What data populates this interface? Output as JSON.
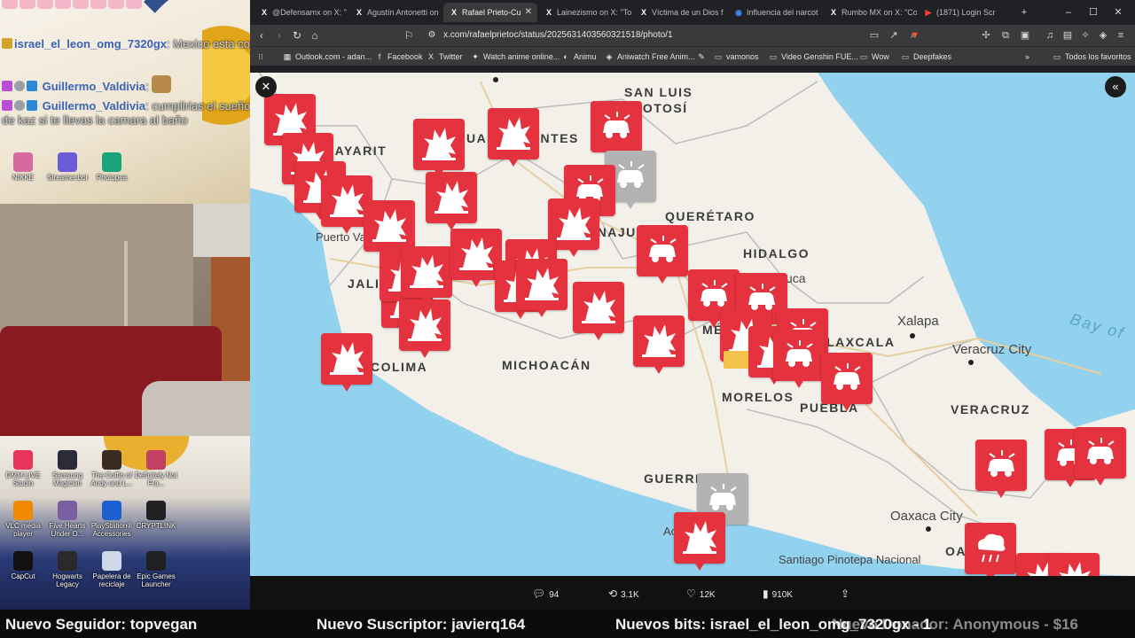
{
  "chat": {
    "messages": [
      {
        "user": "israel_el_leon_omg_7320gx",
        "text": "",
        "y": 0,
        "emotes": 8
      },
      {
        "user": "israel_el_leon_omg_7320gx",
        "text": "Mexico esta complejo",
        "y": 1
      },
      {
        "user": "Guillermo_Valdivia",
        "text": "",
        "y": 2
      },
      {
        "user": "Guillermo_Valdivia",
        "text": "cumplirias el sueño de kaz si te llevas la camara al baño",
        "y": 3
      }
    ]
  },
  "desktop_top_icons": [
    {
      "label": "NIKKE",
      "color": "#d66aa0"
    },
    {
      "label": "Streamer.bot",
      "color": "#6b5bd6"
    },
    {
      "label": "Photopea",
      "color": "#1aa37a"
    }
  ],
  "desktop_bottom_icons": [
    {
      "label": "DMM LIVE Studio",
      "color": "#e8345c"
    },
    {
      "label": "Samsung Magician",
      "color": "#2b2b3a"
    },
    {
      "label": "The Coffin of Andy and L...",
      "color": "#3a2b22"
    },
    {
      "label": "Definitely Not Fra...",
      "color": "#c24060"
    },
    {
      "label": "VLC media player",
      "color": "#f08a00"
    },
    {
      "label": "Five Hearts Under O...",
      "color": "#7a5fa0"
    },
    {
      "label": "PlayStation® Accessories",
      "color": "#1d5fd0"
    },
    {
      "label": "CRYPTLINK",
      "color": "#222"
    },
    {
      "label": "CapCut",
      "color": "#111"
    },
    {
      "label": "Hogwarts Legacy",
      "color": "#2a2a2a"
    },
    {
      "label": "Papelera de reciclaje",
      "color": "#cfd8e8"
    },
    {
      "label": "Epic Games Launcher",
      "color": "#202020"
    }
  ],
  "browser": {
    "tabs": [
      {
        "icon": "X",
        "title": "@Defensamx on X: \"",
        "active": false
      },
      {
        "icon": "X",
        "title": "Agustín Antonetti on",
        "active": false
      },
      {
        "icon": "X",
        "title": "Rafael Prieto-Cu",
        "active": true
      },
      {
        "icon": "X",
        "title": "Lainezismo on X: \"To",
        "active": false
      },
      {
        "icon": "X",
        "title": "Víctima de un Dios f",
        "active": false
      },
      {
        "icon": "◉",
        "title": "Influencia del narcot",
        "active": false
      },
      {
        "icon": "X",
        "title": "Rumbo MX on X: \"Co",
        "active": false
      },
      {
        "icon": "▶",
        "title": "(1871) Login Scr",
        "active": false
      }
    ],
    "new_tab": "+",
    "url": "x.com/rafaelprietoc/status/2025631403560321518/photo/1",
    "bookmarks": [
      {
        "icon": "▦",
        "label": "Outlook.com - adan..."
      },
      {
        "icon": "f",
        "label": "Facebook"
      },
      {
        "icon": "X",
        "label": "Twitter"
      },
      {
        "icon": "✦",
        "label": "Watch anime online..."
      },
      {
        "icon": "◐",
        "label": "Animu"
      },
      {
        "icon": "◈",
        "label": "Aniwatch Free Anim..."
      },
      {
        "icon": "✎",
        "label": ""
      },
      {
        "icon": "▭",
        "label": "vamonos"
      },
      {
        "icon": "▭",
        "label": "Video Genshin FUE..."
      },
      {
        "icon": "▭",
        "label": "Wow"
      },
      {
        "icon": "▭",
        "label": "Deepfakes"
      }
    ],
    "all_bookmarks": "Todos los favoritos"
  },
  "map": {
    "states": [
      {
        "name": "SAN LUIS",
        "key": "sanluis1"
      },
      {
        "name": "POTOSÍ",
        "key": "sanluis2"
      },
      {
        "name": "AGUASCALIENTES",
        "key": "ags"
      },
      {
        "name": "QUERÉTARO",
        "key": "qro"
      },
      {
        "name": "HIDALGO",
        "key": "hgo"
      },
      {
        "name": "GUANAJUATO",
        "key": "gto"
      },
      {
        "name": "NAYARIT",
        "key": "nay"
      },
      {
        "name": "JALISCO",
        "key": "jal"
      },
      {
        "name": "COLIMA",
        "key": "col"
      },
      {
        "name": "MICHOACÁN",
        "key": "mich"
      },
      {
        "name": "MÉXICO",
        "key": "mex"
      },
      {
        "name": "TLAXCALA",
        "key": "tlax"
      },
      {
        "name": "MORELOS",
        "key": "mor"
      },
      {
        "name": "PUEBLA",
        "key": "pue"
      },
      {
        "name": "VERACRUZ",
        "key": "ver"
      },
      {
        "name": "GUERRERO",
        "key": "gro"
      },
      {
        "name": "OAXACA",
        "key": "oax"
      }
    ],
    "cities": [
      "Pachuca",
      "Xalapa",
      "Veracruz City",
      "Oaxaca City",
      "Santiago Pinotepa Nacional",
      "Acapulco",
      "Puerto Vallarta"
    ],
    "sea_label": "Bay of"
  },
  "actions": {
    "replies": "94",
    "reposts": "3.1K",
    "likes": "12K",
    "views": "910K"
  },
  "ticker": {
    "follower": "Nuevo Seguidor: topvegan",
    "subscriber": "Nuevo Suscriptor: javierq164",
    "bits": "Nuevos bits: israel_el_leon_omg_7320gx - 1",
    "donor": "Nuevo Donador: Anonymous - $16"
  }
}
